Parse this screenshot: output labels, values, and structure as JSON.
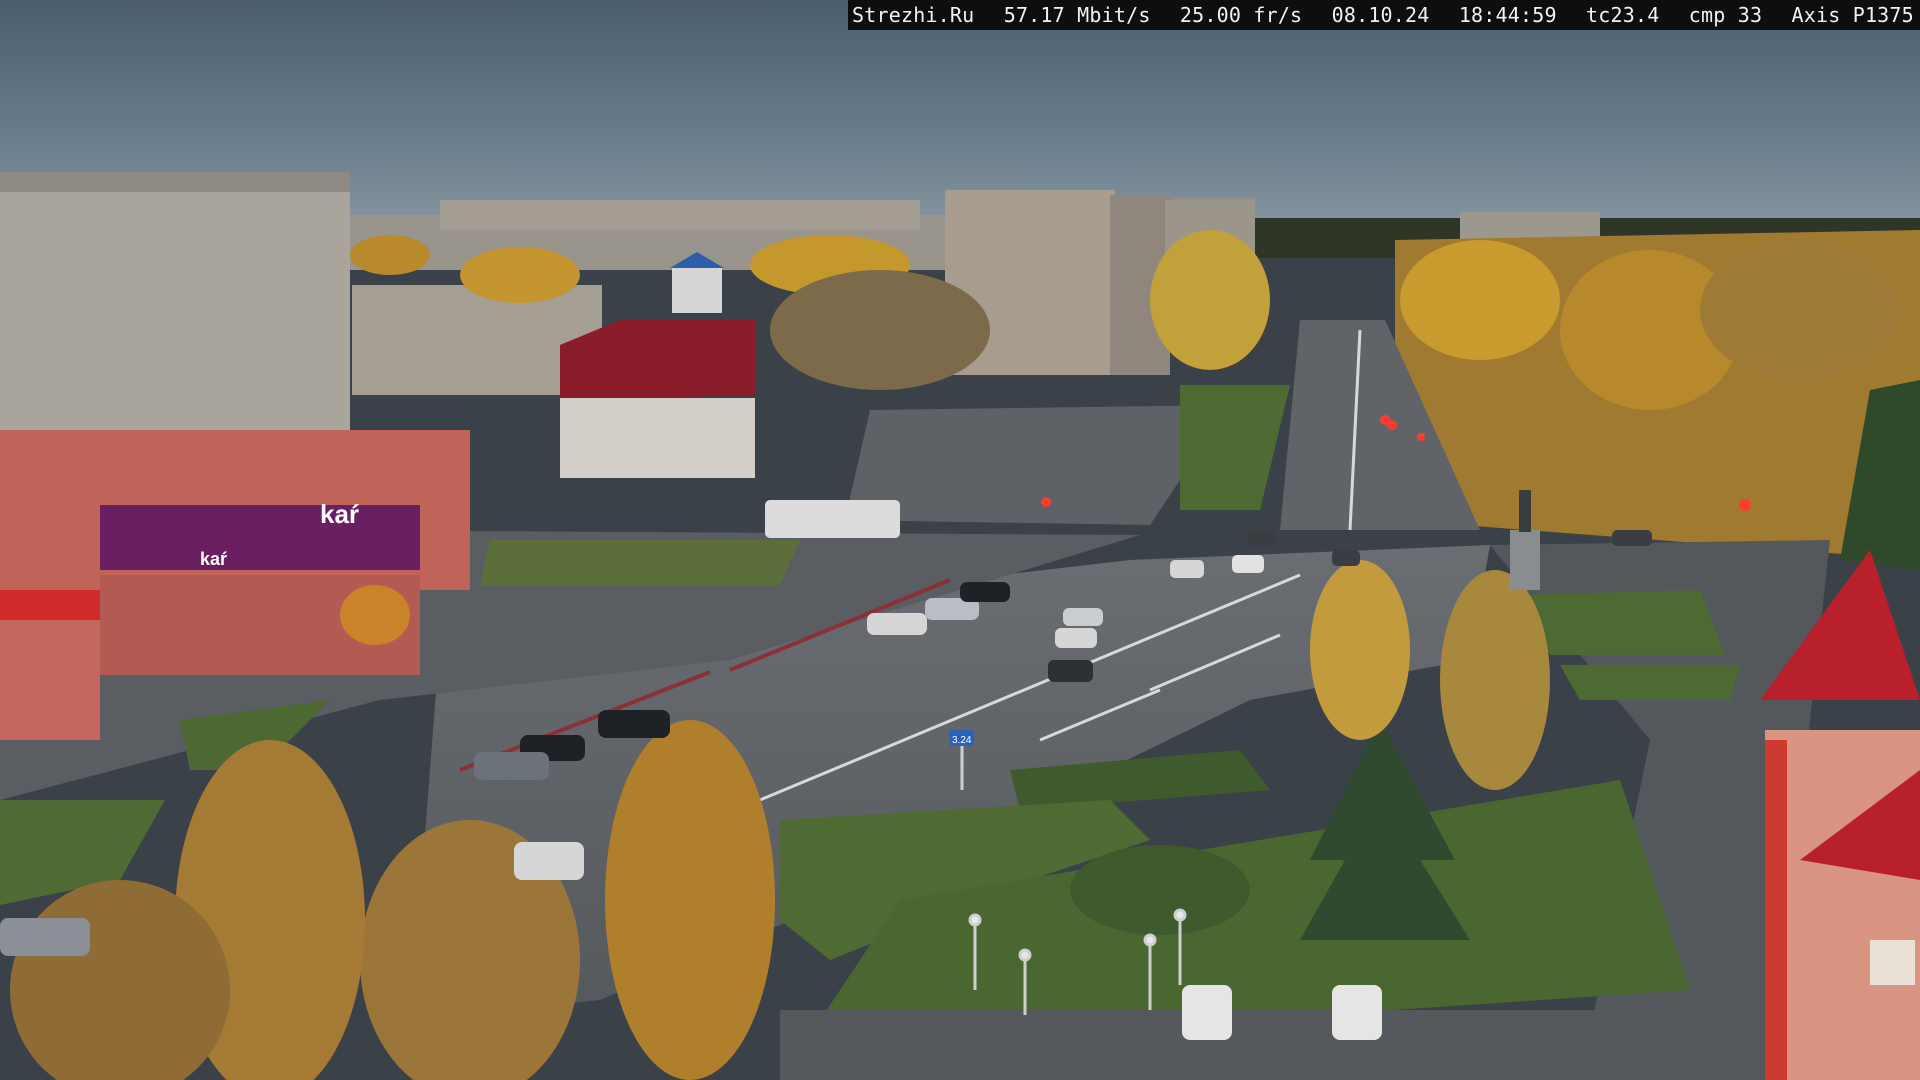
{
  "overlay": {
    "site": "Strezhi.Ru",
    "bitrate": "57.17 Mbit/s",
    "framerate": "25.00 fr/s",
    "date": "08.10.24",
    "time": "18:44:59",
    "tc": "tc23.4",
    "cmp": "cmp 33",
    "camera_model": "Axis P1375"
  },
  "signs": {
    "store_sign": "kaŕ",
    "store_sign_small": "kaŕ",
    "road_sign": "3.24"
  },
  "colors": {
    "sky": "#5f7282",
    "road": "#5d6166",
    "grass": "#4f6a33",
    "foliage": "#c08a2a",
    "brick": "#c2645a",
    "red_roof": "#b8202c",
    "purple_sign": "#6a1f63"
  }
}
